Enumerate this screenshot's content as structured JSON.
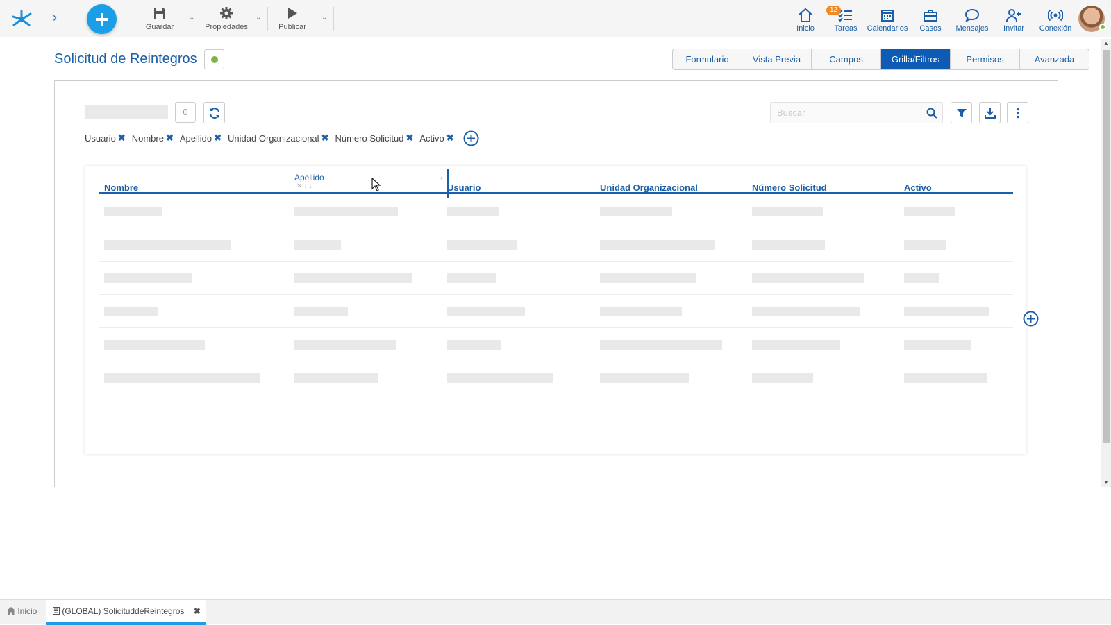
{
  "toolbar": {
    "save_label": "Guardar",
    "properties_label": "Propiedades",
    "publish_label": "Publicar"
  },
  "nav": {
    "home_label": "Inicio",
    "tasks_label": "Tareas",
    "tasks_badge": "12",
    "calendars_label": "Calendarios",
    "cases_label": "Casos",
    "messages_label": "Mensajes",
    "invite_label": "Invitar",
    "connection_label": "Conexión"
  },
  "page": {
    "title": "Solicitud de Reintegros"
  },
  "tabs": [
    {
      "label": "Formulario"
    },
    {
      "label": "Vista Previa"
    },
    {
      "label": "Campos"
    },
    {
      "label": "Grilla/Filtros"
    },
    {
      "label": "Permisos"
    },
    {
      "label": "Avanzada"
    }
  ],
  "grid_toolbar": {
    "count": "0",
    "search_placeholder": "Buscar"
  },
  "filter_chips": [
    {
      "label": "Usuario"
    },
    {
      "label": "Nombre"
    },
    {
      "label": "Apellido"
    },
    {
      "label": "Unidad Organizacional"
    },
    {
      "label": "Número Solicitud"
    },
    {
      "label": "Activo"
    }
  ],
  "columns": [
    {
      "label": "Nombre"
    },
    {
      "label": "Apellido"
    },
    {
      "label": "Usuario"
    },
    {
      "label": "Unidad Organizacional"
    },
    {
      "label": "Número Solicitud"
    },
    {
      "label": "Activo"
    }
  ],
  "taskbar": {
    "home_label": "Inicio",
    "active_tab_label": "(GLOBAL) SolicituddeReintegros"
  },
  "colors": {
    "primary": "#1a5fa8",
    "accent": "#1a9ee5",
    "active_tab": "#0d5bb5",
    "status_dot": "#7cb342",
    "badge": "#f08a24"
  }
}
